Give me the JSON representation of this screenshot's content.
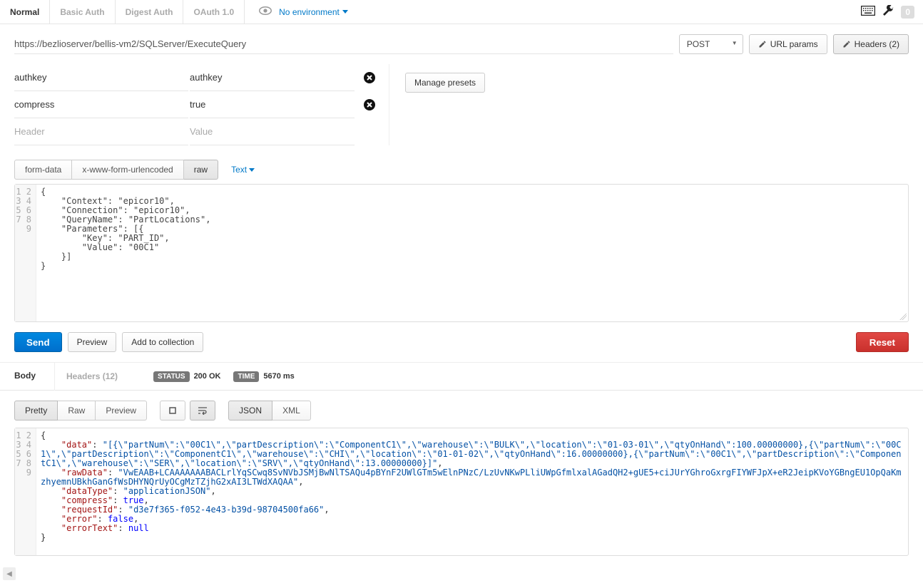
{
  "top_tabs": {
    "items": [
      {
        "label": "Normal",
        "active": true
      },
      {
        "label": "Basic Auth",
        "active": false
      },
      {
        "label": "Digest Auth",
        "active": false
      },
      {
        "label": "OAuth 1.0",
        "active": false
      }
    ],
    "environment_label": "No environment",
    "zero_badge": "0"
  },
  "request": {
    "url": "https://bezlioserver/bellis-vm2/SQLServer/ExecuteQuery",
    "method": "POST",
    "url_params_btn": "URL params",
    "headers_btn": "Headers (2)",
    "manage_presets_btn": "Manage presets"
  },
  "headers": {
    "rows": [
      {
        "key": "authkey",
        "value": "authkey"
      },
      {
        "key": "compress",
        "value": "true"
      }
    ],
    "placeholder_key": "Header",
    "placeholder_value": "Value"
  },
  "body_type": {
    "options": [
      {
        "label": "form-data",
        "active": false
      },
      {
        "label": "x-www-form-urlencoded",
        "active": false
      },
      {
        "label": "raw",
        "active": true
      }
    ],
    "format_label": "Text"
  },
  "request_body": {
    "line_count": 9,
    "text": "{\n    \"Context\": \"epicor10\",\n    \"Connection\": \"epicor10\",\n    \"QueryName\": \"PartLocations\",\n    \"Parameters\": [{\n        \"Key\": \"PART_ID\",\n        \"Value\": \"00C1\"\n    }]\n}"
  },
  "action_buttons": {
    "send": "Send",
    "preview": "Preview",
    "add_collection": "Add to collection",
    "reset": "Reset"
  },
  "response_tabs": {
    "body": "Body",
    "headers": "Headers (12)",
    "status_label": "STATUS",
    "status_value": "200 OK",
    "time_label": "TIME",
    "time_value": "5670 ms"
  },
  "response_view": {
    "options": [
      {
        "label": "Pretty",
        "active": true
      },
      {
        "label": "Raw",
        "active": false
      },
      {
        "label": "Preview",
        "active": false
      }
    ],
    "format_options": [
      {
        "label": "JSON",
        "active": true
      },
      {
        "label": "XML",
        "active": false
      }
    ]
  },
  "response_body": {
    "line_numbers": [
      "1",
      "2",
      "3",
      "4",
      "5",
      "6",
      "7",
      "8",
      "9"
    ],
    "entries": {
      "data_key": "\"data\"",
      "data_val": "\"[{\\\"partNum\\\":\\\"00C1\\\",\\\"partDescription\\\":\\\"ComponentC1\\\",\\\"warehouse\\\":\\\"BULK\\\",\\\"location\\\":\\\"01-03-01\\\",\\\"qtyOnHand\\\":100.00000000},{\\\"partNum\\\":\\\"00C1\\\",\\\"partDescription\\\":\\\"ComponentC1\\\",\\\"warehouse\\\":\\\"CHI\\\",\\\"location\\\":\\\"01-01-02\\\",\\\"qtyOnHand\\\":16.00000000},{\\\"partNum\\\":\\\"00C1\\\",\\\"partDescription\\\":\\\"ComponentC1\\\",\\\"warehouse\\\":\\\"SER\\\",\\\"location\\\":\\\"SRV\\\",\\\"qtyOnHand\\\":13.00000000}]\"",
      "rawData_key": "\"rawData\"",
      "rawData_val": "\"VwEAAB+LCAAAAAAABACLrlYqSCwq8SvNVbJSMjBwNlTSAQu4pBYnF2UWlGTm5wElnPNzC/LzUvNKwPLliUWpGfmlxalAGadQH2+gUE5+ciJUrYGhroGxrgFIYWFJpX+eR2JeipKVoYGBngEU1OpQaKmzhyemnUBkhGanGfWsDHYNQrUyOCgMzTZjhG2xAI3LTWdXAQAA\"",
      "dataType_key": "\"dataType\"",
      "dataType_val": "\"applicationJSON\"",
      "compress_key": "\"compress\"",
      "compress_val": "true",
      "requestId_key": "\"requestId\"",
      "requestId_val": "\"d3e7f365-f052-4e43-b39d-98704500fa66\"",
      "error_key": "\"error\"",
      "error_val": "false",
      "errorText_key": "\"errorText\"",
      "errorText_val": "null"
    }
  }
}
